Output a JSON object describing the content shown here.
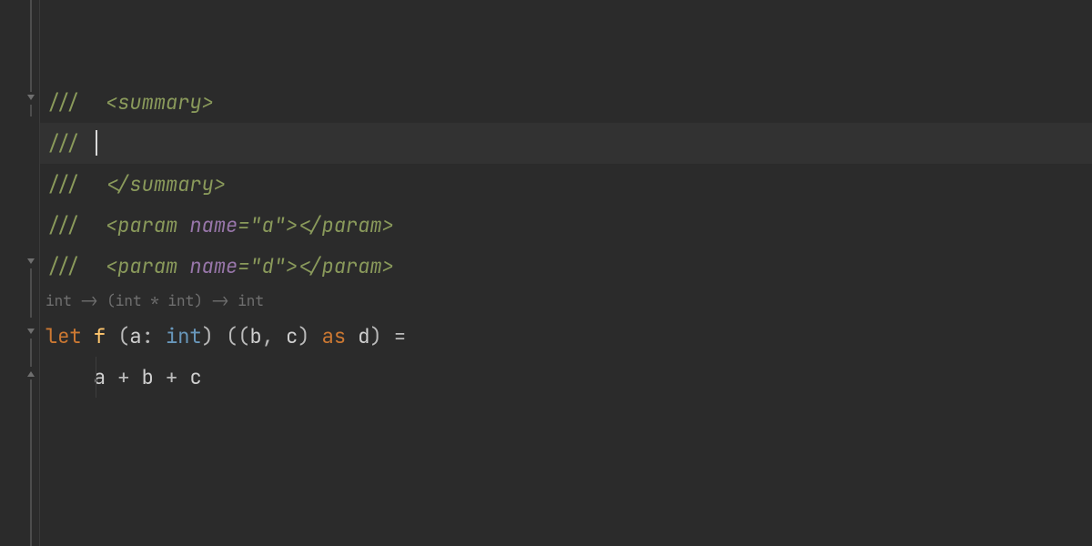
{
  "code": {
    "doc_slash": "///  ",
    "doc_slash_short": "/// ",
    "summary_open": "<summary>",
    "summary_close": "</summary>",
    "param_open_pre": "<param ",
    "param_attr_name": "name",
    "param_eq": "=",
    "param_a_val": "\"a\"",
    "param_d_val": "\"d\"",
    "param_open_post": ">",
    "param_close": "</param>",
    "hint": "int -> (int * int) -> int",
    "kw_let": "let",
    "fn_name": "f",
    "paren_open": "(",
    "paren_close": ")",
    "id_a": "a",
    "id_b": "b",
    "id_c": "c",
    "id_d": "d",
    "colon": ":",
    "type_int": "int",
    "comma": ",",
    "kw_as": "as",
    "eq": "=",
    "plus": "+",
    "indent": "    "
  }
}
